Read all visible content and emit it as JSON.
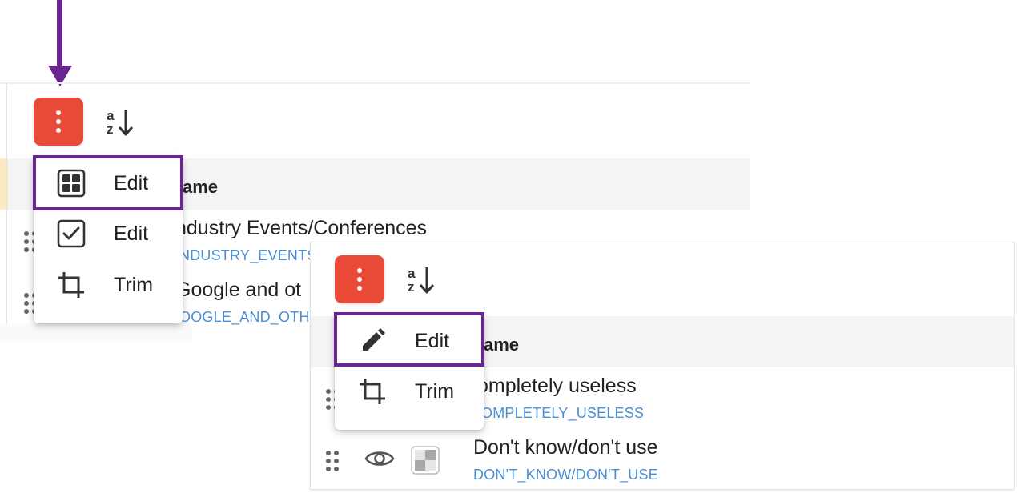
{
  "colors": {
    "accent_button": "#e84a37",
    "highlight_border": "#6a2690",
    "code_text": "#4a8fd6"
  },
  "panel1": {
    "more_button_icon": "more-vertical-icon",
    "sort_button_icon": "sort-alpha-down-icon",
    "column_header": "ame",
    "menu": [
      {
        "icon": "grid-layout-icon",
        "label": "Edit"
      },
      {
        "icon": "checkbox-icon",
        "label": "Edit"
      },
      {
        "icon": "crop-icon",
        "label": "Trim"
      }
    ],
    "rows": [
      {
        "title": "ndustry Events/Conferences",
        "code": "NDUSTRY_EVENTS"
      },
      {
        "title": "Google and ot",
        "code": "OOGLE_AND_OTH"
      }
    ]
  },
  "panel2": {
    "more_button_icon": "more-vertical-icon",
    "sort_button_icon": "sort-alpha-down-icon",
    "column_header": "ame",
    "menu": [
      {
        "icon": "pencil-icon",
        "label": "Edit"
      },
      {
        "icon": "crop-icon",
        "label": "Trim"
      }
    ],
    "rows": [
      {
        "title": "ompletely useless",
        "code": "OMPLETELY_USELESS"
      },
      {
        "title": "Don't know/don't use",
        "code": "DON'T_KNOW/DON'T_USE"
      }
    ]
  }
}
